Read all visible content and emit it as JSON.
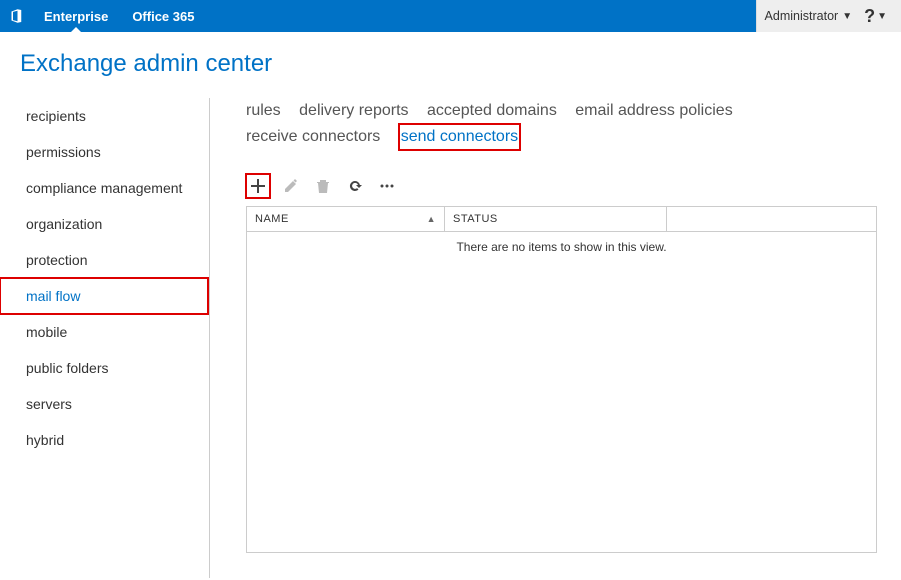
{
  "topbar": {
    "link_enterprise": "Enterprise",
    "link_office365": "Office 365",
    "admin_label": "Administrator"
  },
  "page_title": "Exchange admin center",
  "leftnav": {
    "items": [
      "recipients",
      "permissions",
      "compliance management",
      "organization",
      "protection",
      "mail flow",
      "mobile",
      "public folders",
      "servers",
      "hybrid"
    ],
    "active_index": 5
  },
  "subtabs": {
    "items": [
      "rules",
      "delivery reports",
      "accepted domains",
      "email address policies",
      "receive connectors",
      "send connectors"
    ],
    "active_index": 5
  },
  "toolbar": {
    "add_title": "Add",
    "edit_title": "Edit",
    "delete_title": "Delete",
    "refresh_title": "Refresh",
    "more_title": "More"
  },
  "grid": {
    "columns": {
      "name": "NAME",
      "status": "STATUS"
    },
    "empty_message": "There are no items to show in this view."
  }
}
